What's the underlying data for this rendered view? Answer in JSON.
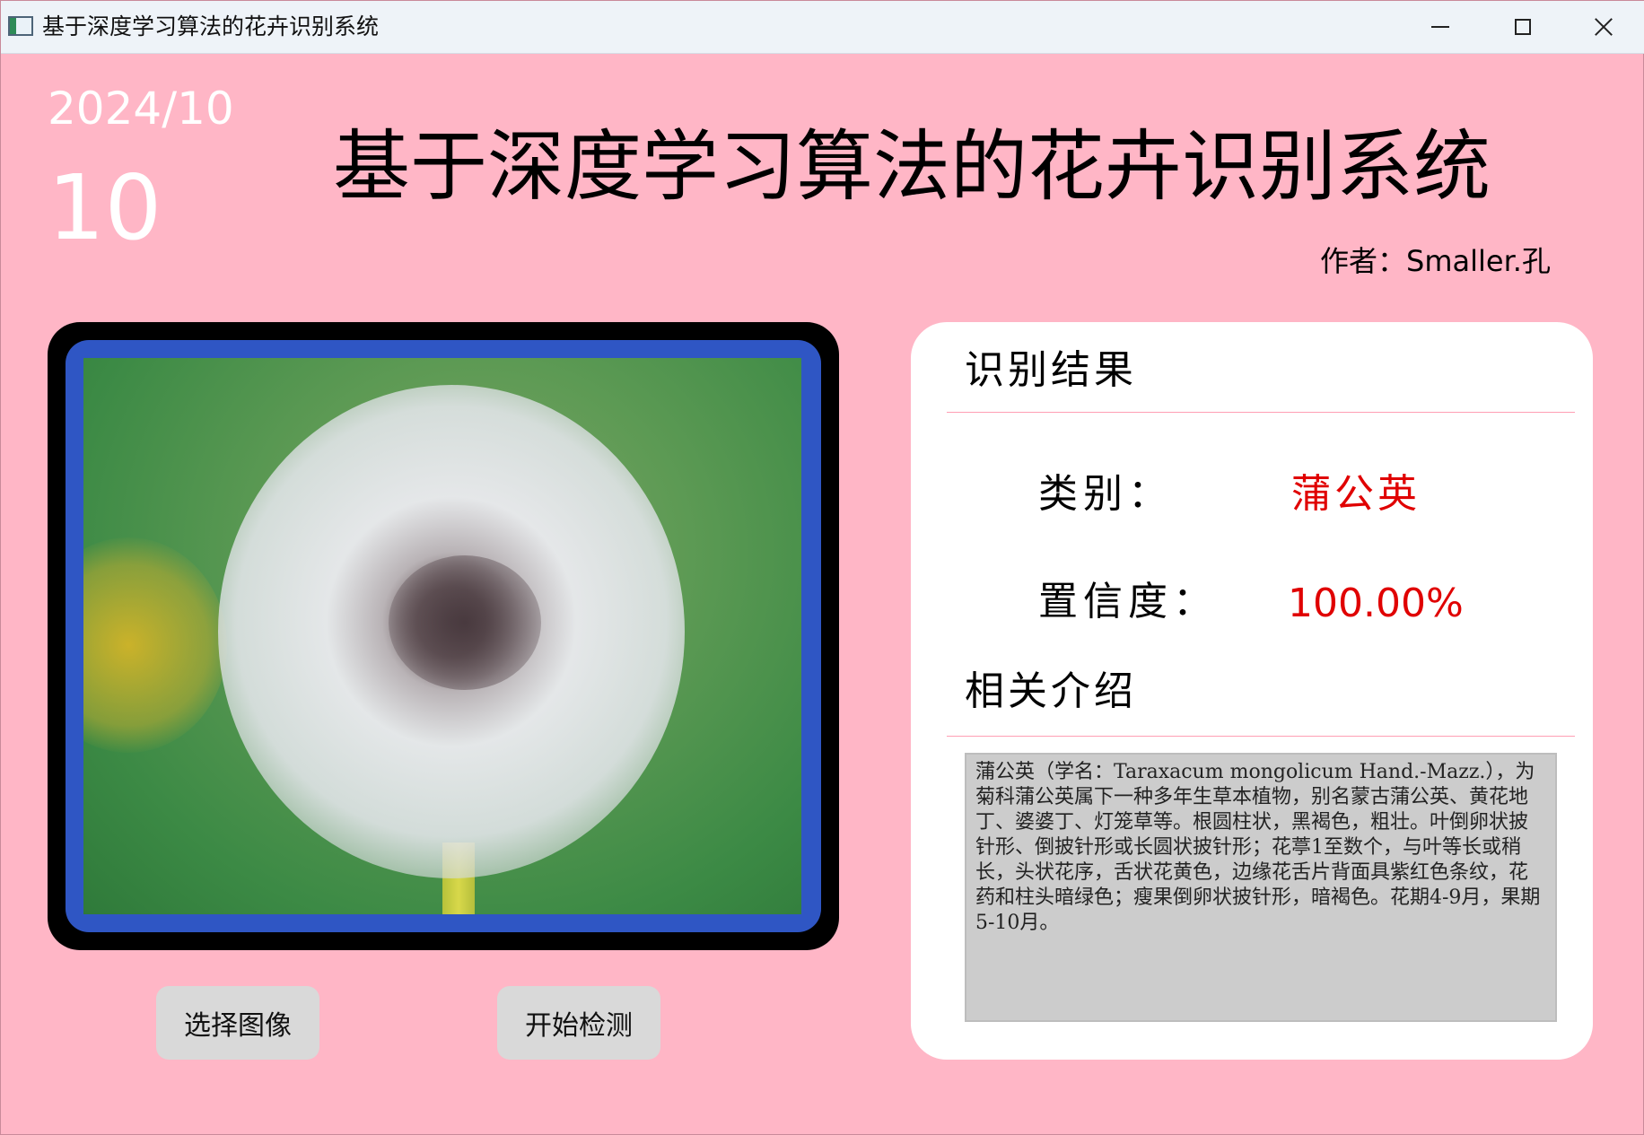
{
  "window": {
    "title": "基于深度学习算法的花卉识别系统",
    "controls": {
      "minimize": "minimize-icon",
      "maximize": "maximize-icon",
      "close": "close-icon"
    }
  },
  "header": {
    "date": "2024/10",
    "day": "10",
    "title": "基于深度学习算法的花卉识别系统",
    "author": "作者：Smaller.孔"
  },
  "image_panel": {
    "image_description": "dandelion-seed-head-photo"
  },
  "buttons": {
    "select_image": "选择图像",
    "start_detect": "开始检测"
  },
  "result": {
    "section_title": "识别结果",
    "category_label": "类别：",
    "category_value": "蒲公英",
    "confidence_label": "置信度：",
    "confidence_value": "100.00%",
    "intro_title": "相关介绍",
    "intro_text": "蒲公英（学名：Taraxacum mongolicum Hand.-Mazz.），为菊科蒲公英属下一种多年生草本植物，别名蒙古蒲公英、黄花地丁、婆婆丁、灯笼草等。根圆柱状，黑褐色，粗壮。叶倒卵状披针形、倒披针形或长圆状披针形；花葶1至数个，与叶等长或稍长，头状花序，舌状花黄色，边缘花舌片背面具紫红色条纹，花药和柱头暗绿色；瘦果倒卵状披针形，暗褐色。花期4-9月，果期5-10月。"
  },
  "colors": {
    "background": "#ffb6c6",
    "accent_red": "#e00000",
    "frame_blue": "#2f56c4"
  }
}
